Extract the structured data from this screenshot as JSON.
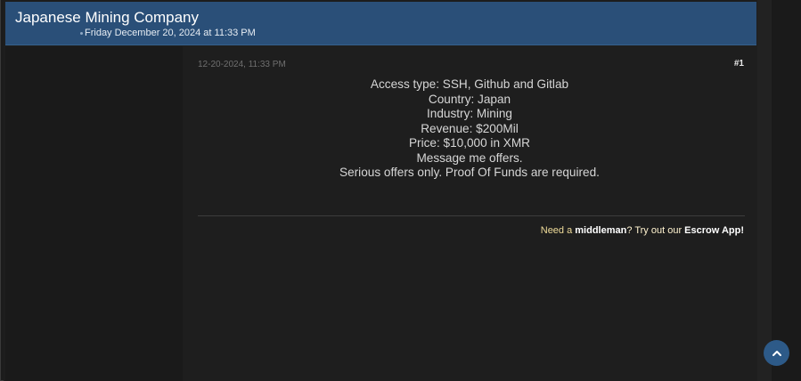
{
  "thread": {
    "title": "Japanese Mining Company",
    "date": "Friday December 20, 2024 at 11:33 PM"
  },
  "post": {
    "date": "12-20-2024, 11:33 PM",
    "number": "#1",
    "lines": [
      "Access type: SSH, Github and Gitlab",
      "Country: Japan",
      "Industry: Mining",
      "Revenue: $200Mil",
      "Price: $10,000 in XMR",
      "Message me offers.",
      "Serious offers only. Proof Of Funds are required."
    ],
    "signature": {
      "prefix": "Need a ",
      "middleman": "middleman",
      "middle": "? Try out our ",
      "escrow": "Escrow App!"
    }
  },
  "controls": {
    "scroll_top_icon": "chevron-up-icon"
  },
  "colors": {
    "header_bg": "#2a4f78",
    "page_bg": "#1e1e1e",
    "signature_accent": "#f0dc9a",
    "scroll_button": "#2d5a88"
  }
}
